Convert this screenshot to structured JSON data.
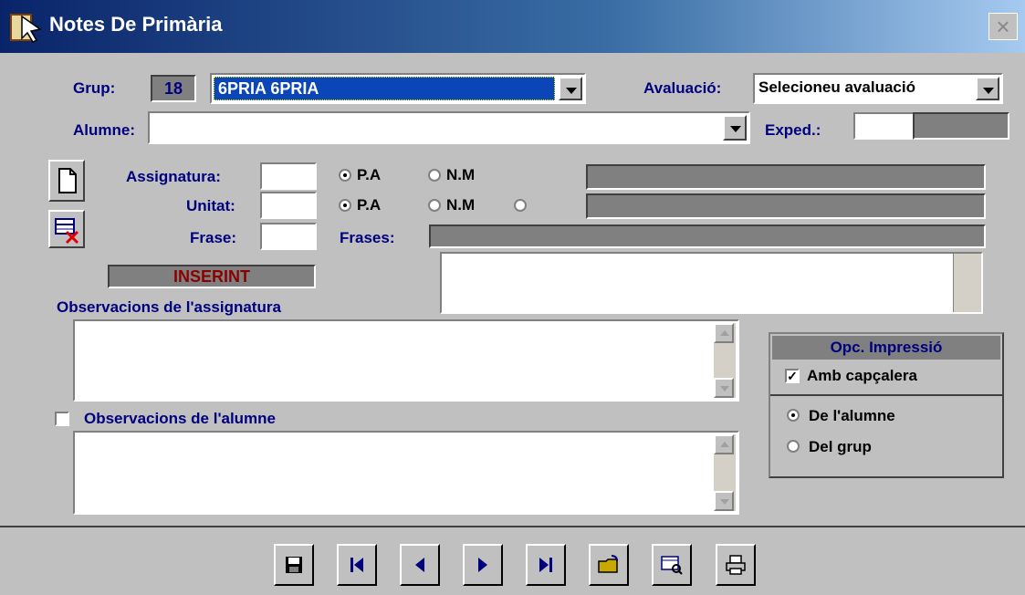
{
  "title": "Notes De Primària",
  "close_glyph": "×",
  "grup": {
    "label": "Grup:",
    "number": "18",
    "value": "6PRIA 6PRIA"
  },
  "avaluacio": {
    "label": "Avaluació:",
    "value": "Selecioneu avaluació"
  },
  "alumne": {
    "label": "Alumne:",
    "value": ""
  },
  "exped": {
    "label": "Exped.:",
    "value": ""
  },
  "assignatura": {
    "label": "Assignatura:",
    "value": "",
    "opt1": "P.A",
    "opt2": "N.M"
  },
  "unitat": {
    "label": "Unitat:",
    "value": "",
    "opt1": "P.A",
    "opt2": "N.M"
  },
  "frase": {
    "label": "Frase:",
    "value": ""
  },
  "frases": {
    "label": "Frases:"
  },
  "status": "INSERINT",
  "obs_assignatura": {
    "label": "Observacions de l'assignatura",
    "value": ""
  },
  "obs_alumne": {
    "label": "Observacions de l'alumne",
    "value": "",
    "checked": false
  },
  "impressio": {
    "header": "Opc. Impressió",
    "amb_capcalera": "Amb capçalera",
    "amb_checked": true,
    "de_alumne": "De l'alumne",
    "del_grup": "Del grup",
    "selected": "de_alumne"
  },
  "toolbar": [
    {
      "name": "save-button",
      "icon": "save-icon"
    },
    {
      "name": "first-record-button",
      "icon": "first-icon"
    },
    {
      "name": "previous-record-button",
      "icon": "previous-icon"
    },
    {
      "name": "next-record-button",
      "icon": "next-icon"
    },
    {
      "name": "last-record-button",
      "icon": "last-icon"
    },
    {
      "name": "open-button",
      "icon": "folder-icon"
    },
    {
      "name": "preview-button",
      "icon": "preview-icon"
    },
    {
      "name": "print-button",
      "icon": "printer-icon"
    }
  ]
}
